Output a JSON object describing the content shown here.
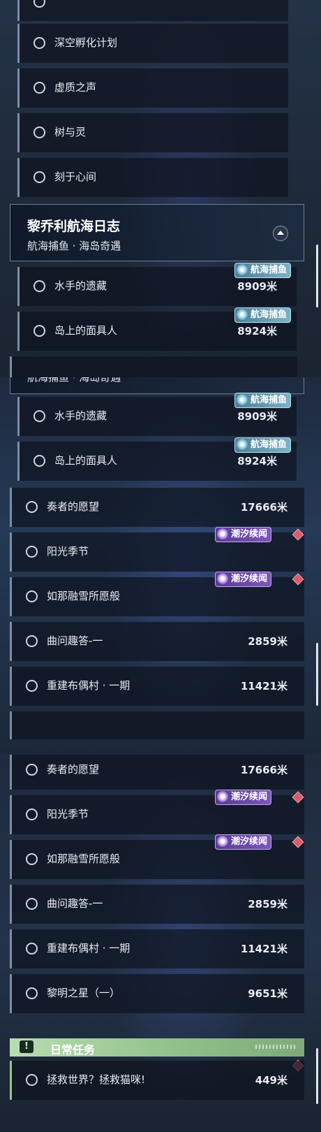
{
  "panel1": {
    "rows": [
      {
        "label": "深空孵化计划"
      },
      {
        "label": "虚质之声"
      },
      {
        "label": "树与灵"
      },
      {
        "label": "刻于心间"
      }
    ],
    "group": {
      "title": "黎乔利航海日志",
      "subtitle": "航海捕鱼 · 海岛奇遇"
    },
    "sub_rows": [
      {
        "label": "水手的遗藏",
        "distance": "8909米",
        "tag": "航海捕鱼"
      },
      {
        "label": "岛上的面具人",
        "distance": "8924米",
        "tag": "航海捕鱼"
      }
    ]
  },
  "panel2": {
    "group_subtitle": "航海捕鱼 · 海岛奇遇",
    "sub_rows": [
      {
        "label": "水手的遗藏",
        "distance": "8909米",
        "tag": "航海捕鱼"
      },
      {
        "label": "岛上的面具人",
        "distance": "8924米",
        "tag": "航海捕鱼"
      }
    ],
    "rows": [
      {
        "label": "奏者的愿望",
        "distance": "17666米"
      },
      {
        "label": "阳光季节",
        "tag": "潮汐续闻"
      },
      {
        "label": "如那融雪所愿般",
        "tag": "潮汐续闻"
      },
      {
        "label": "曲问趣答-一",
        "distance": "2859米"
      },
      {
        "label": "重建布偶村 · 一期",
        "distance": "11421米"
      }
    ]
  },
  "panel3": {
    "rows": [
      {
        "label": "奏者的愿望",
        "distance": "17666米"
      },
      {
        "label": "阳光季节",
        "tag": "潮汐续闻"
      },
      {
        "label": "如那融雪所愿般",
        "tag": "潮汐续闻"
      },
      {
        "label": "曲问趣答-一",
        "distance": "2859米"
      },
      {
        "label": "重建布偶村 · 一期",
        "distance": "11421米"
      },
      {
        "label": "黎明之星（一）",
        "distance": "9651米"
      }
    ],
    "daily": {
      "icon": "!",
      "label": "日常任务"
    },
    "daily_rows": [
      {
        "label": "拯救世界？拯救猫咪!",
        "distance": "449米"
      }
    ]
  },
  "icons": {
    "sea_tag": "wave-fish-icon",
    "tide_tag": "sparkle-icon",
    "track": "red-diamond-marker-icon",
    "collapse": "chevron-up-icon"
  },
  "colors": {
    "sea_tag": "#6a9fb5",
    "tide_tag": "#6a48a6",
    "daily_banner": "#a9d29f",
    "marker": "#d65b6b"
  }
}
